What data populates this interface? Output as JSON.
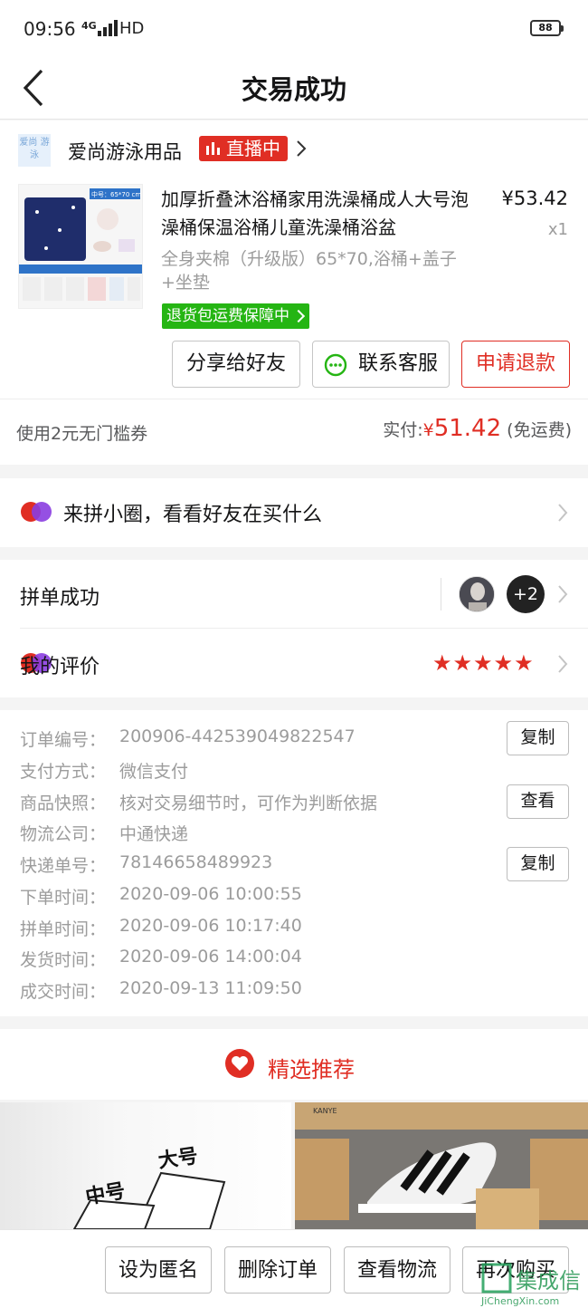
{
  "status_bar": {
    "time": "09:56",
    "network": "4G",
    "hd": "HD",
    "battery": "88"
  },
  "nav": {
    "title": "交易成功",
    "back_icon": "chevron-left-icon"
  },
  "shop": {
    "logo_text": "爱尚 游泳",
    "name": "爱尚游泳用品",
    "live_label": "直播中"
  },
  "product": {
    "title": "加厚折叠沐浴桶家用洗澡桶成人大号泡澡桶保温浴桶儿童洗澡桶浴盆",
    "price": "¥53.42",
    "quantity": "x1",
    "spec": "全身夹棉（升级版）65*70,浴桶+盖子+坐垫",
    "guarantee": "退货包运费保障中",
    "image_label": "中号：65*70 cm"
  },
  "actions": {
    "share": "分享给好友",
    "service": "联系客服",
    "refund": "申请退款"
  },
  "payment": {
    "coupon": "使用2元无门槛券",
    "paid_label": "实付:",
    "currency": "¥",
    "paid_amount": "51.42",
    "shipping": "(免运费)"
  },
  "circle": {
    "label": "来拼小圈，看看好友在买什么"
  },
  "group": {
    "label": "拼单成功",
    "extra_count": "+2"
  },
  "review": {
    "label": "我的评价",
    "stars": "★★★★★",
    "rating": 5
  },
  "order_info": {
    "rows": [
      {
        "label": "订单编号：",
        "value": "200906-442539049822547",
        "button": "复制"
      },
      {
        "label": "支付方式：",
        "value": "微信支付",
        "button": ""
      },
      {
        "label": "商品快照：",
        "value": "核对交易细节时，可作为判断依据",
        "button": "查看"
      },
      {
        "label": "物流公司：",
        "value": "中通快递",
        "button": ""
      },
      {
        "label": "快递单号：",
        "value": "78146658489923",
        "button": "复制"
      },
      {
        "label": "下单时间：",
        "value": "2020-09-06 10:00:55",
        "button": ""
      },
      {
        "label": "拼单时间：",
        "value": "2020-09-06 10:17:40",
        "button": ""
      },
      {
        "label": "发货时间：",
        "value": "2020-09-06 14:00:04",
        "button": ""
      },
      {
        "label": "成交时间：",
        "value": "2020-09-13 11:09:50",
        "button": ""
      }
    ]
  },
  "recommend": {
    "title": "精选推荐",
    "left_card_text_1": "大号",
    "left_card_text_2": "中号",
    "right_card_brand": "KANYE"
  },
  "bottom_bar": {
    "anonymous": "设为匿名",
    "delete": "删除订单",
    "logistics": "查看物流",
    "rebuy": "再次购买"
  },
  "watermark": {
    "site": "JiChengXin.com",
    "name": "集成信"
  }
}
